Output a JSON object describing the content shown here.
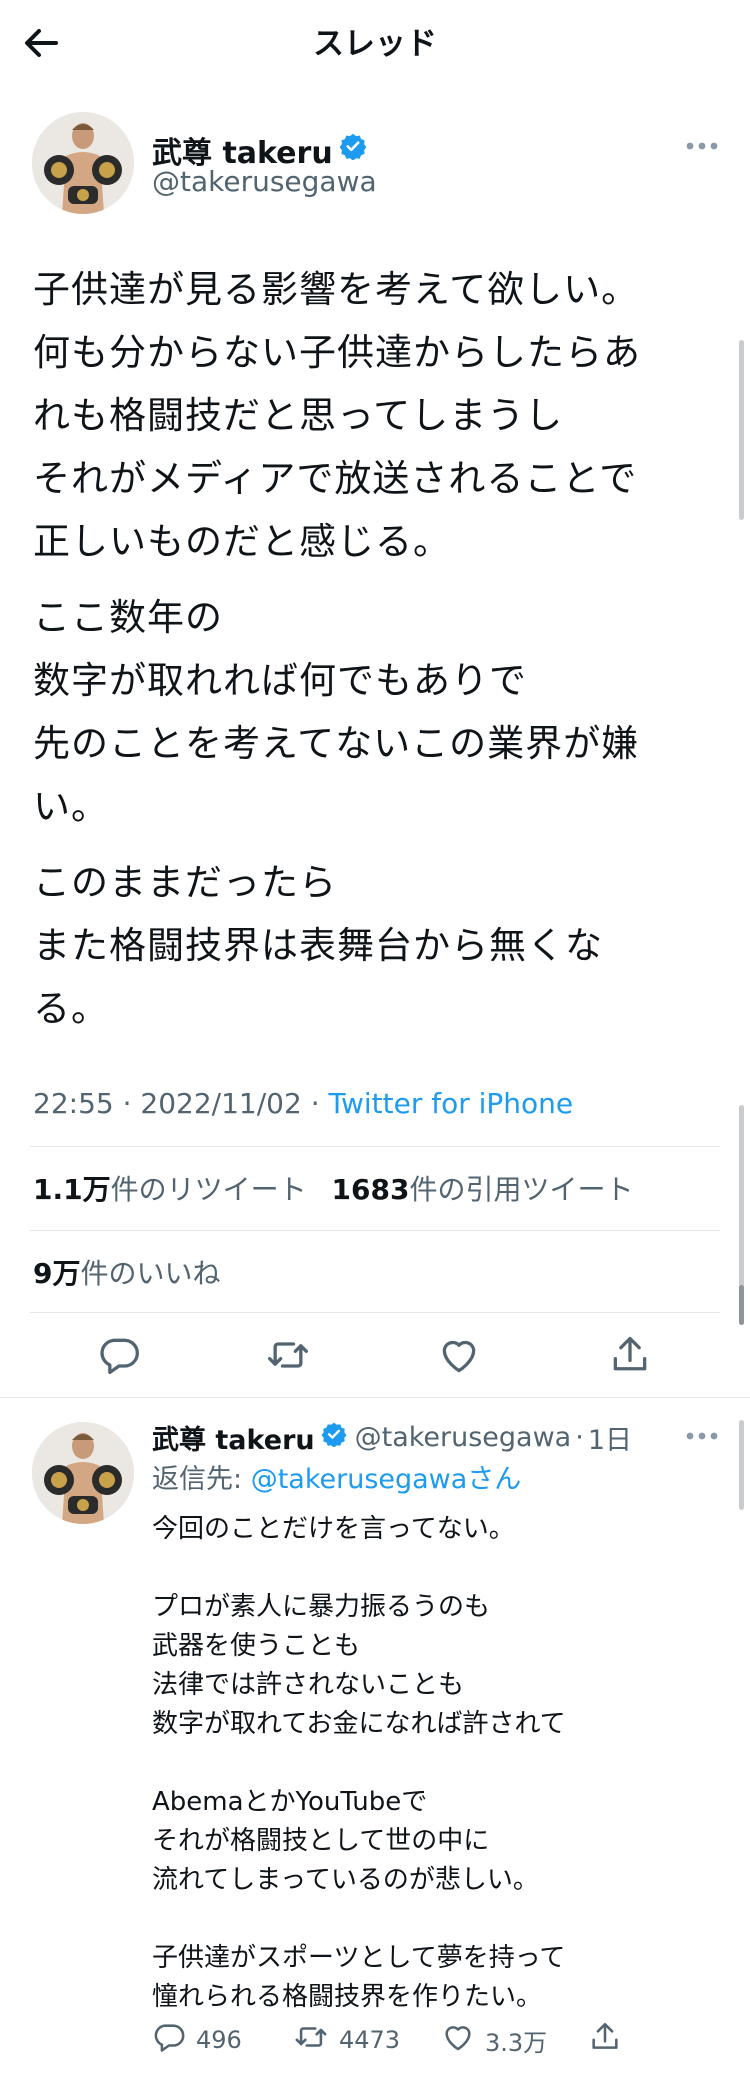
{
  "header": {
    "title": "スレッド"
  },
  "main_tweet": {
    "author_name": "武尊 takeru",
    "handle": "@takerusegawa",
    "paragraphs": [
      "子供達が見る影響を考えて欲しい。\n何も分からない子供達からしたらあ\nれも格闘技だと思ってしまうし\nそれがメディアで放送されることで\n正しいものだと感じる。",
      "ここ数年の\n数字が取れれば何でもありで\n先のことを考えてないこの業界が嫌\nい。",
      "このままだったら\nまた格闘技界は表舞台から無くな\nる。"
    ],
    "time": "22:55",
    "date": "2022/11/02",
    "source": "Twitter for iPhone",
    "retweets_count": "1.1万",
    "retweets_label": "件のリツイート",
    "quotes_count": "1683",
    "quotes_label": "件の引用ツイート",
    "likes_count": "9万",
    "likes_label": "件のいいね"
  },
  "reply_tweet": {
    "author_name": "武尊 takeru",
    "handle": "@takerusegawa",
    "age": "1日",
    "reply_to_prefix": "返信先: ",
    "reply_to_handle": "@takerusegawaさん",
    "text": "今回のことだけを言ってない。\n\nプロが素人に暴力振るうのも\n武器を使うことも\n法律では許されないことも\n数字が取れてお金になれば許されて\n\nAbemaとかYouTubeで\nそれが格闘技として世の中に\n流れてしまっているのが悲しい。\n\n子供達がスポーツとして夢を持って\n憧れられる格闘技界を作りたい。",
    "reply_count": "496",
    "retweet_count": "4473",
    "like_count": "3.3万"
  },
  "colors": {
    "accent": "#1d9bf0",
    "secondary_text": "#536471",
    "text": "#0f1419",
    "divider": "#e3e6e8"
  },
  "icons": [
    "back-arrow-icon",
    "verified-badge-icon",
    "more-icon",
    "reply-icon",
    "retweet-icon",
    "like-icon",
    "share-icon"
  ]
}
